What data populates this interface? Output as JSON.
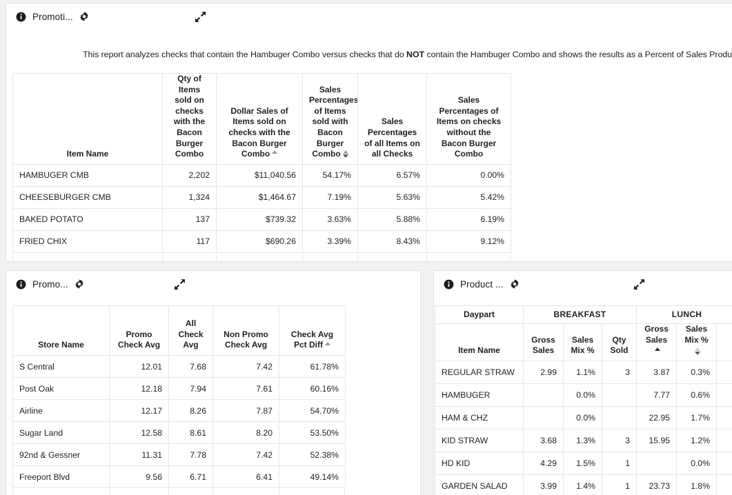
{
  "panels": {
    "top": {
      "title": "Promoti...",
      "info_icon": "info-icon",
      "gear_icon": "gear-icon",
      "expand_icon": "expand-diagonal-icon",
      "description_part1": "This report analyzes checks that contain the Hambuger Combo versus checks that do ",
      "description_emphasis": "NOT",
      "description_part2": " contain the Hambuger Combo and shows the results as a Percent of Sales Product M"
    },
    "bottom_left": {
      "title": "Promo...",
      "info_icon": "info-icon",
      "gear_icon": "gear-icon",
      "expand_icon": "expand-diagonal-icon"
    },
    "bottom_right": {
      "title": "Product ...",
      "info_icon": "info-icon",
      "gear_icon": "gear-icon",
      "expand_icon": "expand-diagonal-icon"
    }
  },
  "main_table": {
    "headers": [
      "Item Name",
      "Qty of Items sold on checks with the Bacon Burger Combo",
      "Dollar Sales of Items sold on checks with the Bacon Burger Combo",
      "Sales Percentages of Items sold with Bacon Burger Combo",
      "Sales Percentages of all Items on all Checks",
      "Sales Percentages of Items on checks without the Bacon Burger Combo"
    ],
    "sort_indicators": [
      "none",
      "none",
      "asc",
      "both",
      "none",
      "none"
    ],
    "rows": [
      {
        "item": "HAMBUGER CMB",
        "qty": "2,202",
        "dollar_sales": "$11,040.56",
        "pct_with": "54.17%",
        "pct_all": "6.57%",
        "pct_without": "0.00%"
      },
      {
        "item": "CHEESEBURGER CMB",
        "qty": "1,324",
        "dollar_sales": "$1,464.67",
        "pct_with": "7.19%",
        "pct_all": "5.63%",
        "pct_without": "5.42%"
      },
      {
        "item": "BAKED POTATO",
        "qty": "137",
        "dollar_sales": "$739.32",
        "pct_with": "3.63%",
        "pct_all": "5.88%",
        "pct_without": "6.19%"
      },
      {
        "item": "FRIED CHIX",
        "qty": "117",
        "dollar_sales": "$690.26",
        "pct_with": "3.39%",
        "pct_all": "8.43%",
        "pct_without": "9.12%"
      }
    ]
  },
  "store_table": {
    "headers": [
      "Store Name",
      "Promo Check Avg",
      "All Check Avg",
      "Non Promo Check Avg",
      "Check Avg Pct Diff"
    ],
    "sort_indicators": [
      "none",
      "none",
      "none",
      "none",
      "asc"
    ],
    "rows": [
      {
        "store": "S Central",
        "promo_avg": "12.01",
        "all_avg": "7.68",
        "non_promo_avg": "7.42",
        "pct_diff": "61.78%"
      },
      {
        "store": "Post Oak",
        "promo_avg": "12.18",
        "all_avg": "7.94",
        "non_promo_avg": "7.61",
        "pct_diff": "60.16%"
      },
      {
        "store": "Airline",
        "promo_avg": "12.17",
        "all_avg": "8.26",
        "non_promo_avg": "7.87",
        "pct_diff": "54.70%"
      },
      {
        "store": "Sugar Land",
        "promo_avg": "12.58",
        "all_avg": "8.61",
        "non_promo_avg": "8.20",
        "pct_diff": "53.50%"
      },
      {
        "store": "92nd & Gessner",
        "promo_avg": "11.31",
        "all_avg": "7.78",
        "non_promo_avg": "7.42",
        "pct_diff": "52.38%"
      },
      {
        "store": "Freeport Blvd",
        "promo_avg": "9.56",
        "all_avg": "6.71",
        "non_promo_avg": "6.41",
        "pct_diff": "49.14%"
      }
    ]
  },
  "product_table": {
    "daypart_label": "Daypart",
    "groups": [
      "BREAKFAST",
      "LUNCH"
    ],
    "headers": [
      "Item Name",
      "Gross Sales",
      "Sales Mix %",
      "Qty Sold",
      "Gross Sales",
      "Sales Mix %"
    ],
    "sort_indicators": [
      "none",
      "none",
      "none",
      "none",
      "asc",
      "both"
    ],
    "rows": [
      {
        "item": "REGULAR STRAW",
        "bf_gross": "2.99",
        "bf_mix": "1.1%",
        "bf_qty": "3",
        "ln_gross": "3.87",
        "ln_mix": "0.3%"
      },
      {
        "item": "HAMBUGER",
        "bf_gross": "",
        "bf_mix": "0.0%",
        "bf_qty": "",
        "ln_gross": "7.77",
        "ln_mix": "0.6%"
      },
      {
        "item": "HAM & CHZ",
        "bf_gross": "",
        "bf_mix": "0.0%",
        "bf_qty": "",
        "ln_gross": "22.95",
        "ln_mix": "1.7%"
      },
      {
        "item": "KID STRAW",
        "bf_gross": "3.68",
        "bf_mix": "1.3%",
        "bf_qty": "3",
        "ln_gross": "15.95",
        "ln_mix": "1.2%"
      },
      {
        "item": "HD KID",
        "bf_gross": "4.29",
        "bf_mix": "1.5%",
        "bf_qty": "1",
        "ln_gross": "",
        "ln_mix": "0.0%"
      },
      {
        "item": "GARDEN SALAD",
        "bf_gross": "3.99",
        "bf_mix": "1.4%",
        "bf_qty": "1",
        "ln_gross": "23.73",
        "ln_mix": "1.8%"
      }
    ]
  },
  "colors": {
    "page_bg": "#f2f2f2",
    "panel_bg": "#ffffff",
    "border": "#e6e6e6",
    "text": "#1f1f1f"
  }
}
